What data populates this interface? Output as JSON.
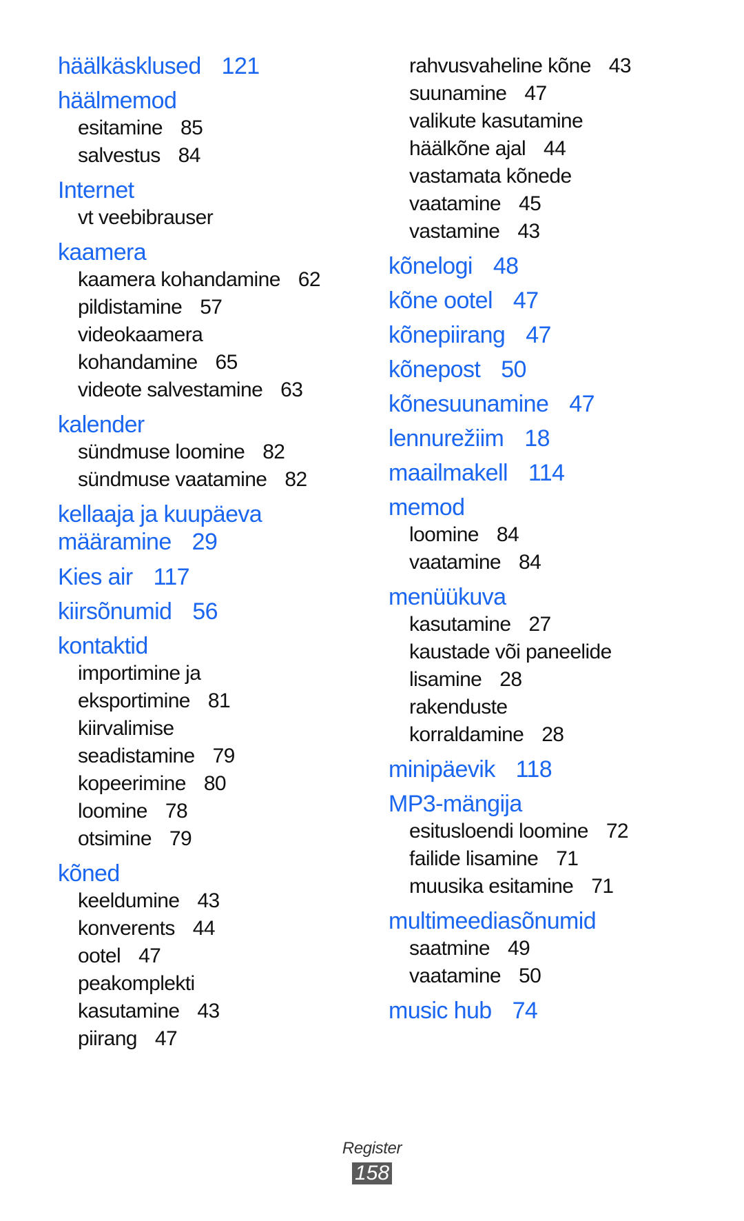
{
  "colors": {
    "heading": "#1a66f0",
    "subentry": "#111111",
    "page_badge_bg": "#5a5a5a"
  },
  "left_column": [
    {
      "term": "häälkäsklused",
      "page": "121",
      "subs": []
    },
    {
      "term": "häälmemod",
      "page": "",
      "subs": [
        {
          "lines": [
            "esitamine"
          ],
          "page": "85"
        },
        {
          "lines": [
            "salvestus"
          ],
          "page": "84"
        }
      ]
    },
    {
      "term": "Internet",
      "page": "",
      "subs": [
        {
          "lines": [
            "vt veebibrauser"
          ],
          "page": ""
        }
      ]
    },
    {
      "term": "kaamera",
      "page": "",
      "subs": [
        {
          "lines": [
            "kaamera kohandamine"
          ],
          "page": "62"
        },
        {
          "lines": [
            "pildistamine"
          ],
          "page": "57"
        },
        {
          "lines": [
            "videokaamera",
            "kohandamine"
          ],
          "page": "65"
        },
        {
          "lines": [
            "videote salvestamine"
          ],
          "page": "63"
        }
      ]
    },
    {
      "term": "kalender",
      "page": "",
      "subs": [
        {
          "lines": [
            "sündmuse loomine"
          ],
          "page": "82"
        },
        {
          "lines": [
            "sündmuse vaatamine"
          ],
          "page": "82"
        }
      ]
    },
    {
      "term_lines": [
        "kellaaja ja kuupäeva",
        "määramine"
      ],
      "page": "29",
      "subs": []
    },
    {
      "term": "Kies air",
      "page": "117",
      "subs": []
    },
    {
      "term": "kiirsõnumid",
      "page": "56",
      "subs": []
    },
    {
      "term": "kontaktid",
      "page": "",
      "subs": [
        {
          "lines": [
            "importimine ja",
            "eksportimine"
          ],
          "page": "81"
        },
        {
          "lines": [
            "kiirvalimise",
            "seadistamine"
          ],
          "page": "79"
        },
        {
          "lines": [
            "kopeerimine"
          ],
          "page": "80"
        },
        {
          "lines": [
            "loomine"
          ],
          "page": "78"
        },
        {
          "lines": [
            "otsimine"
          ],
          "page": "79"
        }
      ]
    },
    {
      "term": "kõned",
      "page": "",
      "subs": [
        {
          "lines": [
            "keeldumine"
          ],
          "page": "43"
        },
        {
          "lines": [
            "konverents"
          ],
          "page": "44"
        },
        {
          "lines": [
            "ootel"
          ],
          "page": "47"
        },
        {
          "lines": [
            "peakomplekti",
            "kasutamine"
          ],
          "page": "43"
        },
        {
          "lines": [
            "piirang"
          ],
          "page": "47"
        }
      ]
    }
  ],
  "right_column": [
    {
      "term": "",
      "page": "",
      "continued": true,
      "subs": [
        {
          "lines": [
            "rahvusvaheline kõne"
          ],
          "page": "43"
        },
        {
          "lines": [
            "suunamine"
          ],
          "page": "47"
        },
        {
          "lines": [
            "valikute kasutamine",
            "häälkõne ajal"
          ],
          "page": "44"
        },
        {
          "lines": [
            "vastamata kõnede",
            "vaatamine"
          ],
          "page": "45"
        },
        {
          "lines": [
            "vastamine"
          ],
          "page": "43"
        }
      ]
    },
    {
      "term": "kõnelogi",
      "page": "48",
      "subs": []
    },
    {
      "term": "kõne ootel",
      "page": "47",
      "subs": []
    },
    {
      "term": "kõnepiirang",
      "page": "47",
      "subs": []
    },
    {
      "term": "kõnepost",
      "page": "50",
      "subs": []
    },
    {
      "term": "kõnesuunamine",
      "page": "47",
      "subs": []
    },
    {
      "term": "lennurežiim",
      "page": "18",
      "subs": []
    },
    {
      "term": "maailmakell",
      "page": "114",
      "subs": []
    },
    {
      "term": "memod",
      "page": "",
      "subs": [
        {
          "lines": [
            "loomine"
          ],
          "page": "84"
        },
        {
          "lines": [
            "vaatamine"
          ],
          "page": "84"
        }
      ]
    },
    {
      "term": "menüükuva",
      "page": "",
      "subs": [
        {
          "lines": [
            "kasutamine"
          ],
          "page": "27"
        },
        {
          "lines": [
            "kaustade või paneelide",
            "lisamine"
          ],
          "page": "28"
        },
        {
          "lines": [
            "rakenduste",
            "korraldamine"
          ],
          "page": "28"
        }
      ]
    },
    {
      "term": "minipäevik",
      "page": "118",
      "subs": []
    },
    {
      "term": "MP3-mängija",
      "page": "",
      "subs": [
        {
          "lines": [
            "esitusloendi loomine"
          ],
          "page": "72"
        },
        {
          "lines": [
            "failide lisamine"
          ],
          "page": "71"
        },
        {
          "lines": [
            "muusika esitamine"
          ],
          "page": "71"
        }
      ]
    },
    {
      "term": "multimeediasõnumid",
      "page": "",
      "subs": [
        {
          "lines": [
            "saatmine"
          ],
          "page": "49"
        },
        {
          "lines": [
            "vaatamine"
          ],
          "page": "50"
        }
      ]
    },
    {
      "term": "music hub",
      "page": "74",
      "subs": []
    }
  ],
  "footer": {
    "section_title": "Register",
    "page_number": "158"
  }
}
